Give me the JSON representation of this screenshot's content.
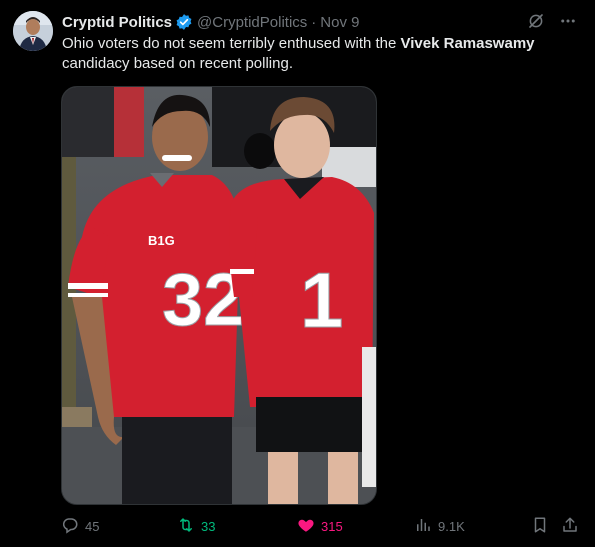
{
  "author": {
    "display_name": "Cryptid Politics",
    "handle": "@CryptidPolitics",
    "separator": "·",
    "date": "Nov 9"
  },
  "tweet": {
    "text_before": "Ohio voters do not seem terribly enthused with the ",
    "text_bold": "Vivek Ramaswamy",
    "text_after": " candidacy based on recent polling."
  },
  "media": {
    "left_jersey_number": "32",
    "right_jersey_number": "1",
    "left_badge_text": "B1G"
  },
  "metrics": {
    "replies": "45",
    "retweets": "33",
    "likes": "315",
    "views": "9.1K"
  },
  "colors": {
    "background": "#000000",
    "text": "#e7e9ea",
    "muted": "#71767b",
    "verified": "#1d9bf0",
    "retweet_active": "#00ba7c",
    "like_active": "#f91880",
    "jersey_red": "#d3202f"
  },
  "icons": {
    "verified": "verified-badge-icon",
    "grok": "grok-icon",
    "more": "more-icon",
    "reply": "reply-icon",
    "retweet": "retweet-icon",
    "like": "heart-icon",
    "views": "views-icon",
    "bookmark": "bookmark-icon",
    "share": "share-icon"
  }
}
